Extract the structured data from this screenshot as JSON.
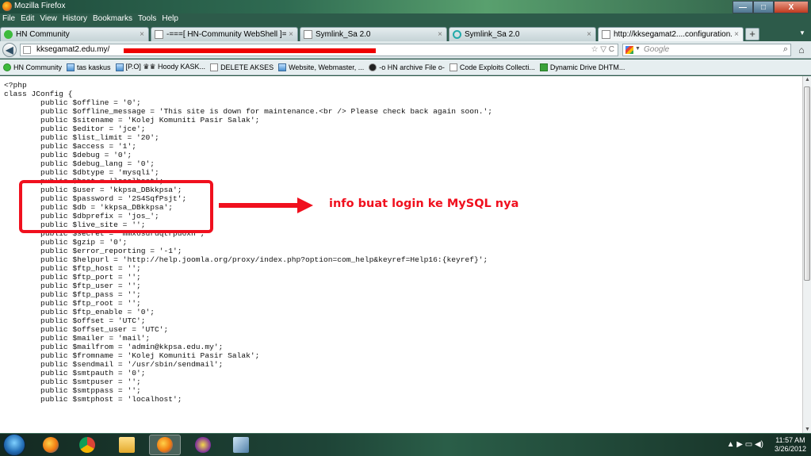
{
  "window": {
    "title": "Mozilla Firefox",
    "controls": {
      "minimize": "—",
      "maximize": "□",
      "close": "X"
    }
  },
  "menu": [
    "File",
    "Edit",
    "View",
    "History",
    "Bookmarks",
    "Tools",
    "Help"
  ],
  "tabs": [
    {
      "label": "HN Community",
      "icon": "hn-favicon",
      "active": false
    },
    {
      "label": "-===[ HN-Community WebShell ]==...",
      "icon": "blank-page-icon",
      "active": false
    },
    {
      "label": "Symlink_Sa 2.0",
      "icon": "blank-page-icon",
      "active": false
    },
    {
      "label": "Symlink_Sa 2.0",
      "icon": "loading-icon",
      "active": false
    },
    {
      "label": "http://kksegamat2....configuration.php",
      "icon": "blank-page-icon",
      "active": true
    }
  ],
  "new_tab_label": "+",
  "tab_list_label": "▼",
  "navbar": {
    "back_label": "◀",
    "url": "kksegamat2.edu.my/",
    "url_icons": "☆ ▽ C",
    "search_placeholder": "Google",
    "search_engine_arrow": "▼",
    "search_button": "⌕",
    "home_label": "⌂"
  },
  "bookmarks": [
    {
      "label": "HN Community",
      "icon": "green"
    },
    {
      "label": "tas kaskus",
      "icon": "img"
    },
    {
      "label": "[P.O] ♛♛ Hoody KASK...",
      "icon": "img"
    },
    {
      "label": "DELETE AKSES",
      "icon": "page"
    },
    {
      "label": "Website, Webmaster, ...",
      "icon": "img"
    },
    {
      "label": "-o HN archive File o-",
      "icon": "dark"
    },
    {
      "label": "Code Exploits Collecti...",
      "icon": "page"
    },
    {
      "label": "Dynamic Drive DHTM...",
      "icon": "dd"
    }
  ],
  "code_lines": [
    "<?php",
    "class JConfig {",
    "        public $offline = '0';",
    "        public $offline_message = 'This site is down for maintenance.<br /> Please check back again soon.';",
    "        public $sitename = 'Kolej Komuniti Pasir Salak';",
    "        public $editor = 'jce';",
    "        public $list_limit = '20';",
    "        public $access = '1';",
    "        public $debug = '0';",
    "        public $debug_lang = '0';",
    "        public $dbtype = 'mysqli';",
    "        public $host = 'localhost';",
    "        public $user = 'kkpsa_DBkkpsa';",
    "        public $password = '2S4SqfPsjt';",
    "        public $db = 'kkpsa_DBkkpsa';",
    "        public $dbprefix = 'jos_';",
    "        public $live_site = '';",
    "        public $secret = 'mmx6surdqtrpu6xn';",
    "        public $gzip = '0';",
    "        public $error_reporting = '-1';",
    "        public $helpurl = 'http://help.joomla.org/proxy/index.php?option=com_help&keyref=Help16:{keyref}';",
    "        public $ftp_host = '';",
    "        public $ftp_port = '';",
    "        public $ftp_user = '';",
    "        public $ftp_pass = '';",
    "        public $ftp_root = '';",
    "        public $ftp_enable = '0';",
    "        public $offset = 'UTC';",
    "        public $offset_user = 'UTC';",
    "        public $mailer = 'mail';",
    "        public $mailfrom = 'admin@kkpsa.edu.my';",
    "        public $fromname = 'Kolej Komuniti Pasir Salak';",
    "        public $sendmail = '/usr/sbin/sendmail';",
    "        public $smtpauth = '0';",
    "        public $smtpuser = '';",
    "        public $smtppass = '';",
    "        public $smtphost = 'localhost';"
  ],
  "annotation": "info buat login ke MySQL nya",
  "taskbar": {
    "apps": [
      "firefox-icon",
      "chrome-icon",
      "folder-icon",
      "firefox-icon",
      "yahoo-messenger-icon",
      "virtualbox-icon"
    ],
    "tray": "▲  ▶  ▭  ◀)",
    "time": "11:57 AM",
    "date": "3/26/2012"
  },
  "colors": {
    "annotation_red": "#f0101e",
    "redaction_red": "#e00000"
  }
}
